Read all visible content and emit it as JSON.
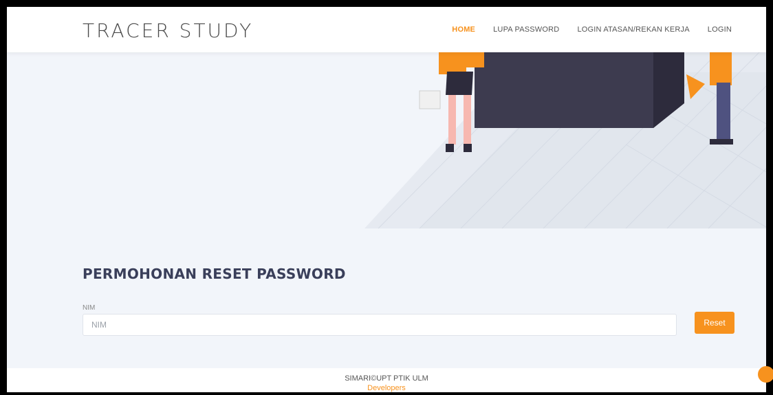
{
  "brand": "TRACER STUDY",
  "nav": {
    "home": "HOME",
    "lupa_password": "LUPA PASSWORD",
    "login_atasan": "LOGIN ATASAN/REKAN KERJA",
    "login": "LOGIN"
  },
  "form": {
    "title": "PERMOHONAN RESET PASSWORD",
    "nim_label": "NIM",
    "nim_placeholder": "NIM",
    "nim_value": "",
    "reset_label": "Reset"
  },
  "footer": {
    "copyright": "SIMARI©UPT PTIK ULM",
    "developers": "Developers"
  },
  "colors": {
    "accent": "#f7921e",
    "title": "#3a3f5a",
    "background": "#f2f5fa"
  }
}
